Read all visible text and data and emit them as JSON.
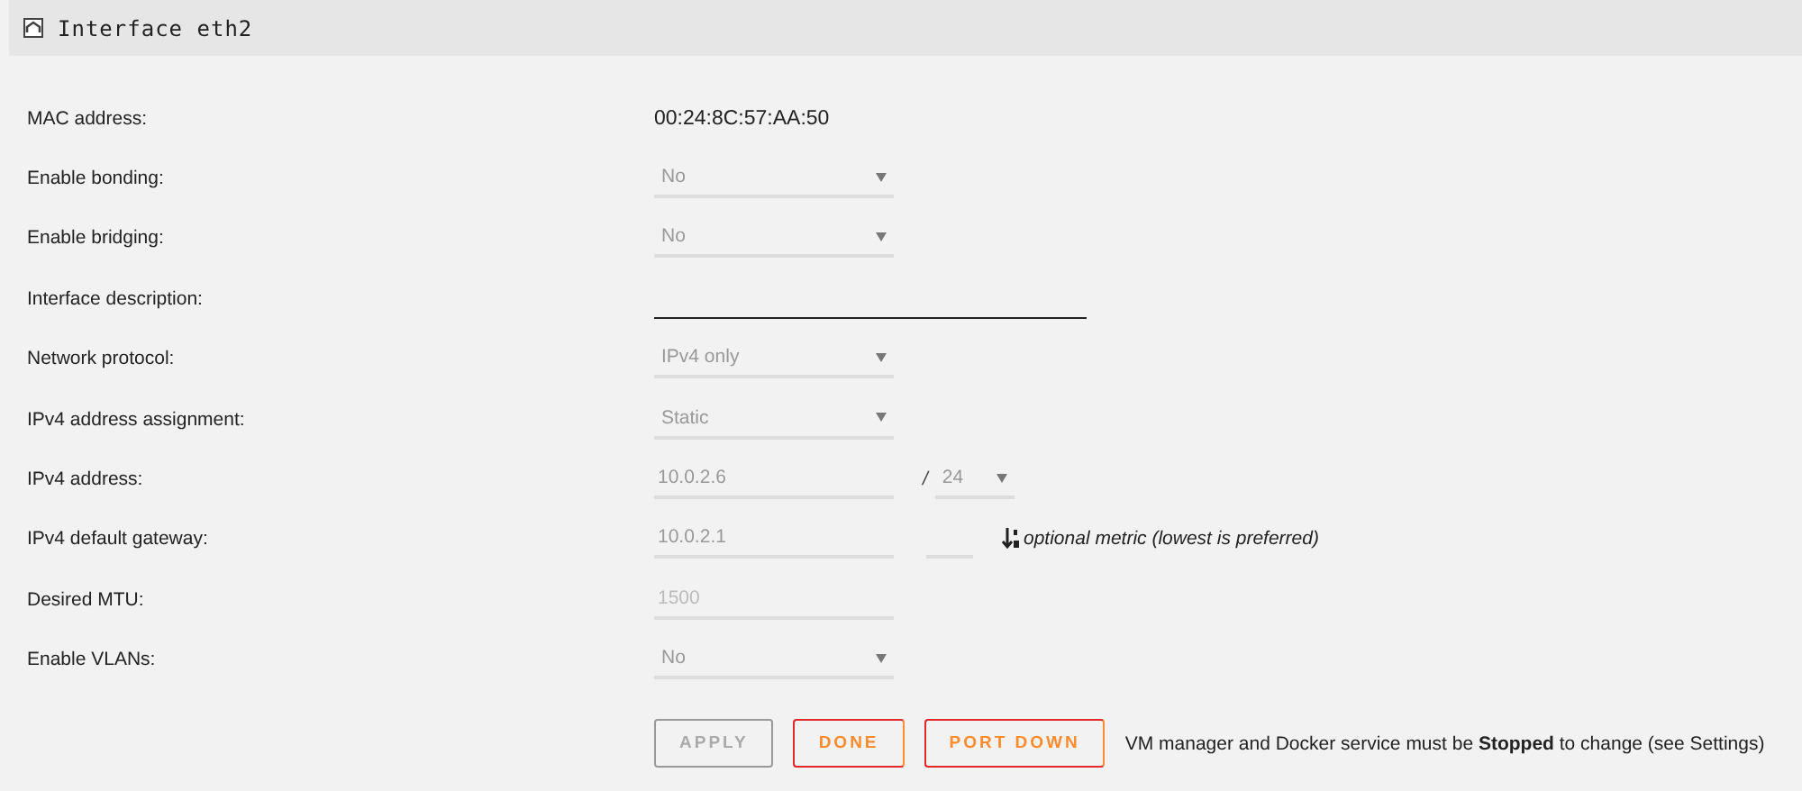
{
  "header": {
    "title": "Interface eth2"
  },
  "rows": [
    {
      "kind": "text",
      "label": "MAC address:",
      "value": "00:24:8C:57:AA:50"
    },
    {
      "kind": "select",
      "label": "Enable bonding:",
      "value": "No",
      "disabled": true
    },
    {
      "kind": "select",
      "label": "Enable bridging:",
      "value": "No",
      "disabled": true
    },
    {
      "kind": "input",
      "label": "Interface description:",
      "disabled": false
    },
    {
      "kind": "select",
      "label": "Network protocol:",
      "value": "IPv4 only",
      "disabled": true
    },
    {
      "kind": "select",
      "label": "IPv4 address assignment:",
      "value": "Static",
      "disabled": true
    },
    {
      "kind": "ip",
      "label": "IPv4 address:",
      "value": "10.0.2.6",
      "separator": "/",
      "prefix": "24",
      "disabled": true
    },
    {
      "kind": "gateway",
      "label": "IPv4 default gateway:",
      "value": "10.0.2.1",
      "hint": "optional metric (lowest is preferred)",
      "disabled": true
    },
    {
      "kind": "input",
      "label": "Desired MTU:",
      "placeholder": "1500",
      "disabled": true
    },
    {
      "kind": "select",
      "label": "Enable VLANs:",
      "value": "No",
      "disabled": true
    }
  ],
  "buttons": [
    {
      "label": "APPLY",
      "disabled": true
    },
    {
      "label": "DONE",
      "disabled": false
    },
    {
      "label": "PORT DOWN",
      "disabled": false
    }
  ],
  "note": "VM manager and Docker service must be **Stopped** to change (see Settings)"
}
